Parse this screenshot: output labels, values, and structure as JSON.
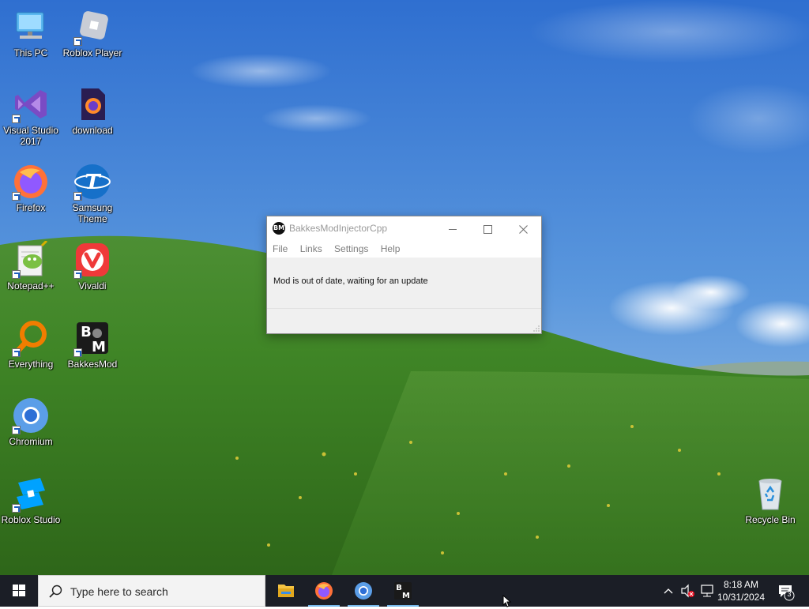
{
  "desktop": {
    "icons": [
      {
        "name": "this-pc",
        "label": "This PC"
      },
      {
        "name": "roblox-player",
        "label": "Roblox Player"
      },
      {
        "name": "visual-studio-2017",
        "label": "Visual Studio 2017"
      },
      {
        "name": "download",
        "label": "download"
      },
      {
        "name": "firefox",
        "label": "Firefox"
      },
      {
        "name": "samsung-theme",
        "label": "Samsung Theme"
      },
      {
        "name": "notepad-plus-plus",
        "label": "Notepad++"
      },
      {
        "name": "vivaldi",
        "label": "Vivaldi"
      },
      {
        "name": "everything",
        "label": "Everything"
      },
      {
        "name": "bakkesmod",
        "label": "BakkesMod"
      },
      {
        "name": "chromium",
        "label": "Chromium"
      },
      {
        "name": "roblox-studio",
        "label": "Roblox Studio"
      },
      {
        "name": "recycle-bin",
        "label": "Recycle Bin"
      }
    ]
  },
  "window": {
    "icon_text": "BM",
    "title": "BakkesModInjectorCpp",
    "menu": [
      "File",
      "Links",
      "Settings",
      "Help"
    ],
    "message": "Mod is out of date, waiting for an update"
  },
  "taskbar": {
    "search_placeholder": "Type here to search",
    "apps": [
      "file-explorer",
      "firefox",
      "chromium",
      "bakkesmod"
    ],
    "clock_time": "8:18 AM",
    "clock_date": "10/31/2024",
    "notification_count": "3"
  },
  "colors": {
    "taskbar": "#1b1e26",
    "accent": "#76b9ed"
  }
}
